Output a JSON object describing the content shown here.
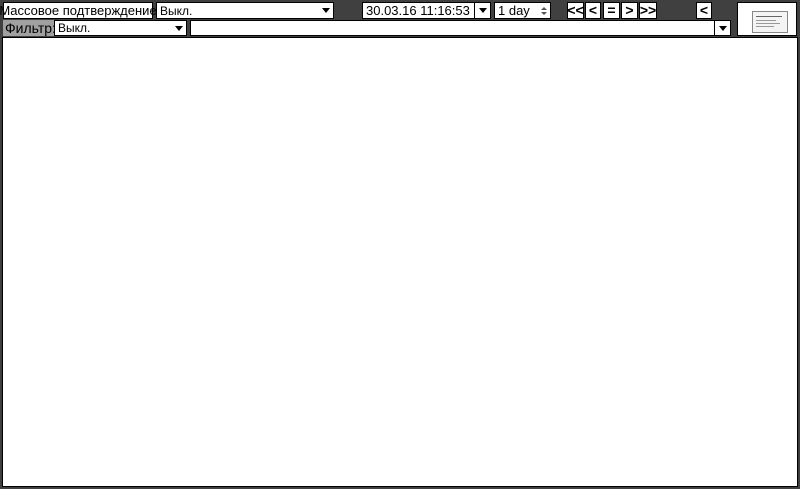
{
  "toolbar": {
    "mass_confirm_label": "Массовое подтверждение",
    "mode_select_value": "Выкл.",
    "datetime_value": "30.03.16 11:16:53",
    "period_value": "1 day",
    "nav": {
      "first_label": "<<",
      "prev_label": "<",
      "now_label": "=",
      "next_label": ">",
      "last_label": ">>",
      "collapse_label": "<"
    }
  },
  "filter": {
    "label": "Фильтр:",
    "select_value": "Выкл.",
    "text_value": ""
  },
  "colors": {
    "background": "#404040",
    "panel": "#ffffff",
    "border": "#000000"
  }
}
